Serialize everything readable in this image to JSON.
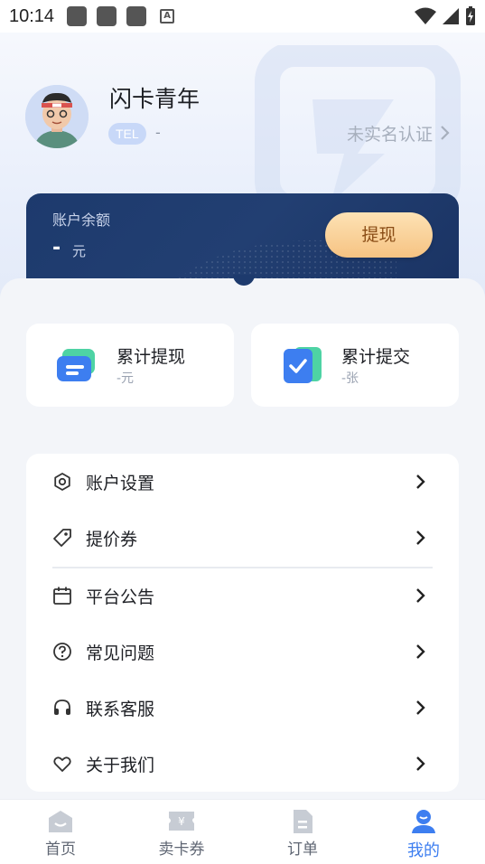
{
  "status_bar": {
    "time": "10:14"
  },
  "profile": {
    "nickname": "闪卡青年",
    "tel_label": "TEL",
    "tel_value": "-",
    "realname_status": "未实名认证"
  },
  "balance": {
    "label": "账户余额",
    "amount": "-",
    "unit": "元",
    "withdraw_label": "提现"
  },
  "stats": [
    {
      "title": "累计提现",
      "value": "-元",
      "icon": "wallet-icon"
    },
    {
      "title": "累计提交",
      "value": "-张",
      "icon": "checklist-icon"
    }
  ],
  "menu": [
    {
      "label": "账户设置",
      "icon": "gear-icon"
    },
    {
      "label": "提价券",
      "icon": "tag-icon"
    },
    {
      "label": "平台公告",
      "icon": "calendar-icon"
    },
    {
      "label": "常见问题",
      "icon": "question-icon"
    },
    {
      "label": "联系客服",
      "icon": "headset-icon"
    },
    {
      "label": "关于我们",
      "icon": "heart-icon"
    }
  ],
  "nav": [
    {
      "label": "首页",
      "icon": "home-icon"
    },
    {
      "label": "卖卡券",
      "icon": "ticket-icon"
    },
    {
      "label": "订单",
      "icon": "document-icon"
    },
    {
      "label": "我的",
      "icon": "user-icon",
      "active": true
    }
  ],
  "colors": {
    "accent": "#3d7ef0",
    "card_navy": "#1d3a6d",
    "withdraw_gold": "#f6c382"
  }
}
